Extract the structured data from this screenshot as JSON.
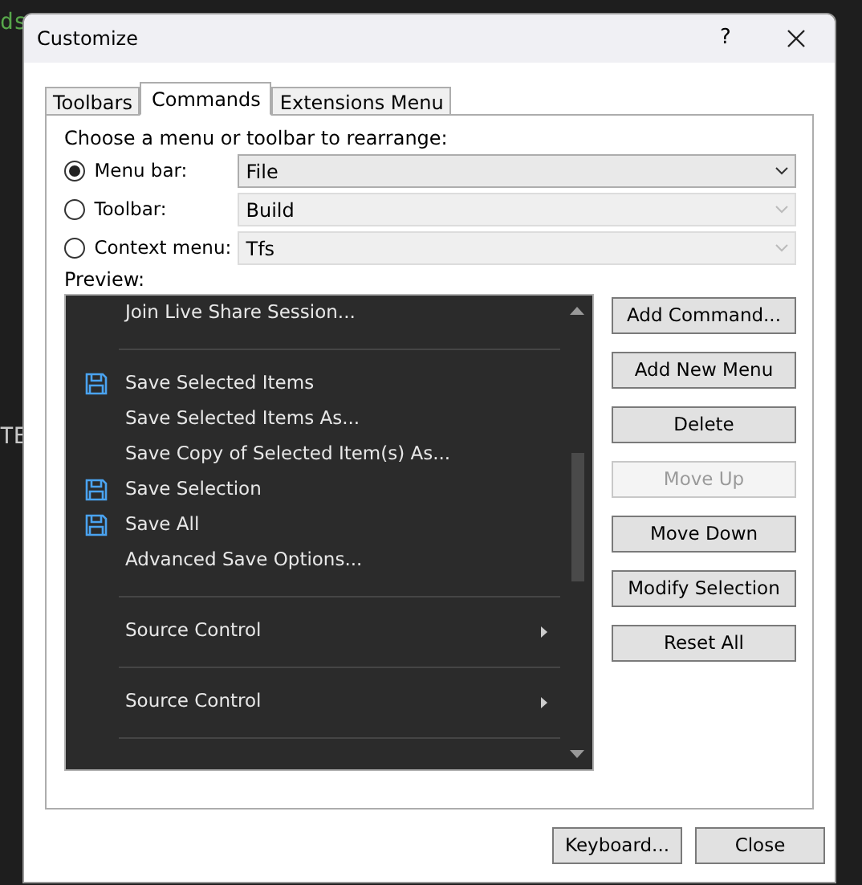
{
  "background_code": [
    {
      "text": "ds"
    },
    {
      "text": "TE"
    }
  ],
  "window": {
    "title": "Customize",
    "help": "?"
  },
  "tabs": [
    {
      "label": "Toolbars",
      "selected": false
    },
    {
      "label": "Commands",
      "selected": true
    },
    {
      "label": "Extensions Menu",
      "selected": false
    }
  ],
  "prompt": "Choose a menu or toolbar to rearrange:",
  "choices": [
    {
      "label": "Menu bar:",
      "selected": true,
      "value": "File",
      "disabled": false
    },
    {
      "label": "Toolbar:",
      "selected": false,
      "value": "Build",
      "disabled": true
    },
    {
      "label": "Context menu:",
      "selected": false,
      "value": "Tfs",
      "disabled": true
    }
  ],
  "preview": {
    "label": "Preview:",
    "items": [
      {
        "kind": "item",
        "label": "Join Live Share Session...",
        "icon": false
      },
      {
        "kind": "separator"
      },
      {
        "kind": "item",
        "label": "Save Selected Items",
        "icon": true
      },
      {
        "kind": "item",
        "label": "Save Selected Items As...",
        "icon": false
      },
      {
        "kind": "item",
        "label": "Save Copy of Selected Item(s) As...",
        "icon": false
      },
      {
        "kind": "item",
        "label": "Save Selection",
        "icon": true
      },
      {
        "kind": "item",
        "label": "Save All",
        "icon": true
      },
      {
        "kind": "item",
        "label": "Advanced Save Options...",
        "icon": false
      },
      {
        "kind": "separator"
      },
      {
        "kind": "submenu",
        "label": "Source Control",
        "icon": false
      },
      {
        "kind": "separator"
      },
      {
        "kind": "submenu",
        "label": "Source Control",
        "icon": false
      },
      {
        "kind": "separator"
      }
    ]
  },
  "side_buttons": [
    {
      "label": "Add Command...",
      "disabled": false
    },
    {
      "label": "Add New Menu",
      "disabled": false
    },
    {
      "label": "Delete",
      "disabled": false
    },
    {
      "label": "Move Up",
      "disabled": true
    },
    {
      "label": "Move Down",
      "disabled": false
    },
    {
      "label": "Modify Selection",
      "disabled": false
    },
    {
      "label": "Reset All",
      "disabled": false
    }
  ],
  "footer_buttons": [
    "Keyboard...",
    "Close"
  ]
}
